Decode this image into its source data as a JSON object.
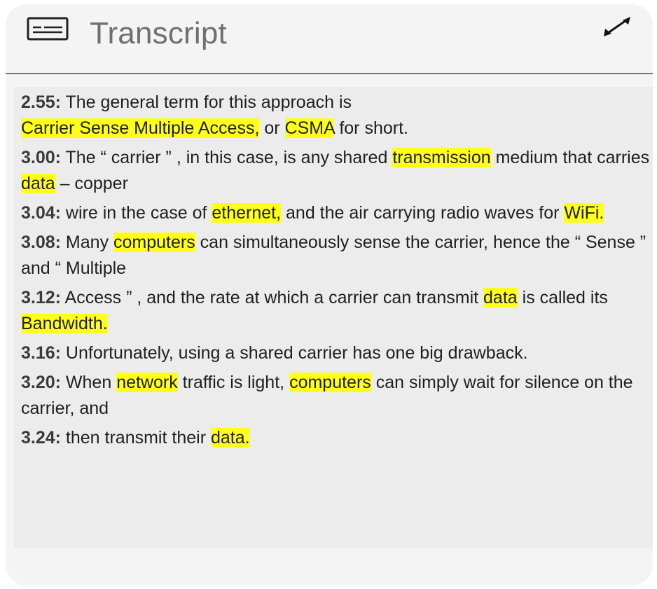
{
  "header": {
    "title": "Transcript",
    "left_icon": "closed-caption-icon",
    "right_icon": "expand-icon"
  },
  "transcript": {
    "highlight_color": "#ffff1a",
    "lines": [
      {
        "timestamp": "2.55:",
        "segments": [
          {
            "text": " The general term for this approach is",
            "highlight": false
          },
          {
            "break": true
          },
          {
            "text": "Carrier Sense Multiple Access,",
            "highlight": true
          },
          {
            "text": " or ",
            "highlight": false
          },
          {
            "text": "CSMA",
            "highlight": true
          },
          {
            "text": " for short.",
            "highlight": false
          }
        ]
      },
      {
        "timestamp": "3.00:",
        "segments": [
          {
            "text": " The “ carrier ” , in this case, is any shared ",
            "highlight": false
          },
          {
            "text": "transmission",
            "highlight": true
          },
          {
            "text": " medium that carries ",
            "highlight": false
          },
          {
            "text": "data",
            "highlight": true
          },
          {
            "text": " – copper",
            "highlight": false
          }
        ]
      },
      {
        "timestamp": "3.04:",
        "segments": [
          {
            "text": " wire in the case of ",
            "highlight": false
          },
          {
            "text": "ethernet,",
            "highlight": true
          },
          {
            "text": " and the air carrying radio waves for ",
            "highlight": false
          },
          {
            "text": "WiFi.",
            "highlight": true
          }
        ]
      },
      {
        "timestamp": "3.08:",
        "segments": [
          {
            "text": " Many ",
            "highlight": false
          },
          {
            "text": "computers",
            "highlight": true
          },
          {
            "text": " can simultaneously sense the carrier, hence the “ Sense ” and “ Multiple",
            "highlight": false
          }
        ]
      },
      {
        "timestamp": "3.12:",
        "segments": [
          {
            "text": " Access ” , and the rate at which a carrier can transmit ",
            "highlight": false
          },
          {
            "text": "data",
            "highlight": true
          },
          {
            "text": " is called its ",
            "highlight": false
          },
          {
            "text": "Bandwidth.",
            "highlight": true
          }
        ]
      },
      {
        "timestamp": "3.16:",
        "segments": [
          {
            "text": " Unfortunately, using a shared carrier has one big drawback.",
            "highlight": false
          }
        ]
      },
      {
        "timestamp": "3.20:",
        "segments": [
          {
            "text": " When ",
            "highlight": false
          },
          {
            "text": "network",
            "highlight": true
          },
          {
            "text": " traffic is light, ",
            "highlight": false
          },
          {
            "text": "computers",
            "highlight": true
          },
          {
            "text": " can simply wait for silence on the carrier, and",
            "highlight": false
          }
        ]
      },
      {
        "timestamp": "3.24:",
        "segments": [
          {
            "text": " then transmit their ",
            "highlight": false
          },
          {
            "text": "data.",
            "highlight": true
          }
        ]
      }
    ]
  }
}
